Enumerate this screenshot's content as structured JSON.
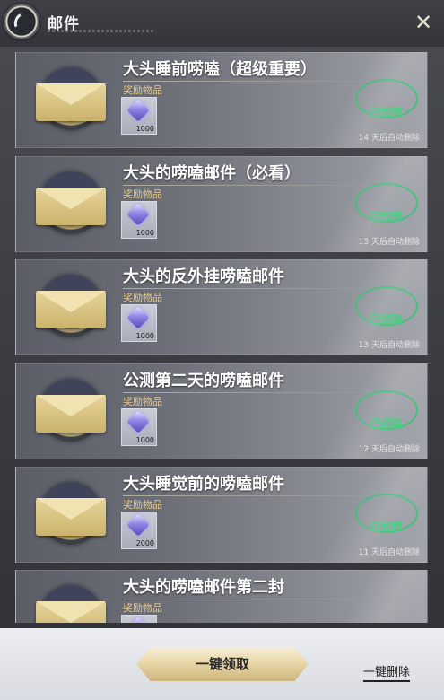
{
  "header": {
    "title": "邮件"
  },
  "mails": [
    {
      "title": "大头睡前唠嗑（超级重要）",
      "reward_label": "奖励物品",
      "item_qty": "1000",
      "stamp_text": "已领取",
      "expire_text": "14 天后自动删除"
    },
    {
      "title": "大头的唠嗑邮件（必看）",
      "reward_label": "奖励物品",
      "item_qty": "1000",
      "stamp_text": "已领取",
      "expire_text": "13 天后自动删除"
    },
    {
      "title": "大头的反外挂唠嗑邮件",
      "reward_label": "奖励物品",
      "item_qty": "1000",
      "stamp_text": "已领取",
      "expire_text": "13 天后自动删除"
    },
    {
      "title": "公测第二天的唠嗑邮件",
      "reward_label": "奖励物品",
      "item_qty": "1000",
      "stamp_text": "已领取",
      "expire_text": "12 天后自动删除"
    },
    {
      "title": "大头睡觉前的唠嗑邮件",
      "reward_label": "奖励物品",
      "item_qty": "2000",
      "stamp_text": "已领取",
      "expire_text": "11 天后自动删除"
    },
    {
      "title": "大头的唠嗑邮件第二封",
      "reward_label": "奖励物品",
      "item_qty": "",
      "stamp_text": "",
      "expire_text": ""
    }
  ],
  "footer": {
    "claim_all_label": "一键领取",
    "delete_all_label": "一键删除"
  },
  "colors": {
    "accent_gold": "#d9c38a",
    "claimed_green": "#35d27a",
    "reward_label": "#e8c98e"
  }
}
